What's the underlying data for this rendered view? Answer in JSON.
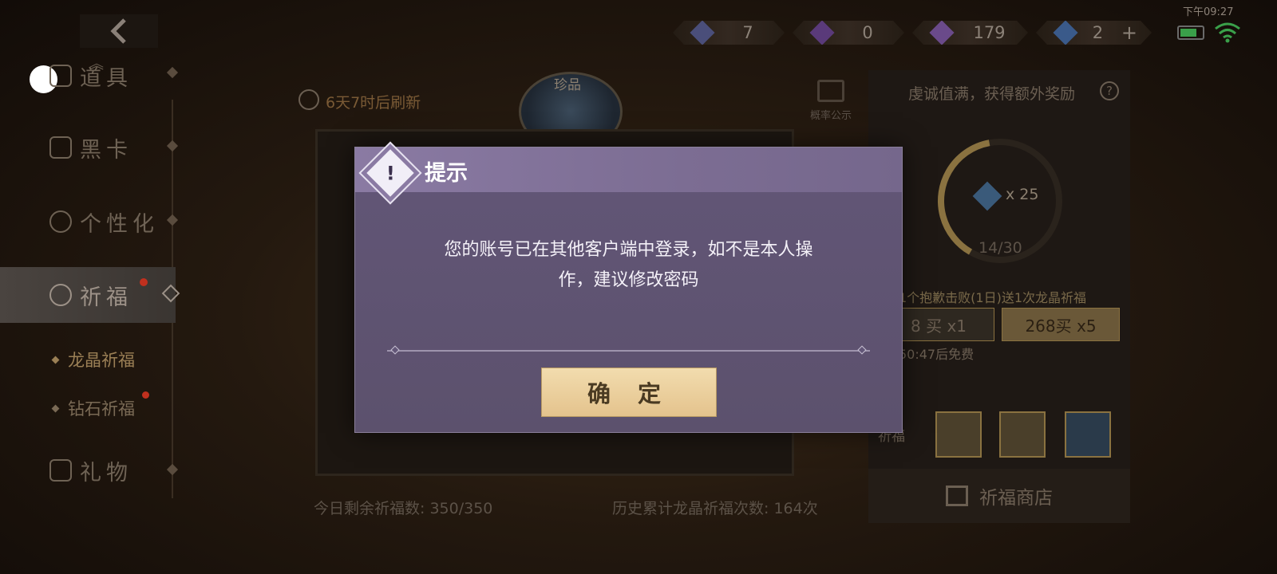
{
  "status": {
    "time": "下午09:27"
  },
  "resources": [
    {
      "icon": "ticket-icon",
      "value": "7"
    },
    {
      "icon": "crystal-icon",
      "value": "0"
    },
    {
      "icon": "purple-diamond-icon",
      "value": "179"
    },
    {
      "icon": "blue-diamond-icon",
      "value": "2"
    }
  ],
  "nav": {
    "items": [
      {
        "label": "道具"
      },
      {
        "label": "黑卡"
      },
      {
        "label": "个性化"
      },
      {
        "label": "祈福"
      },
      {
        "label": "礼物"
      }
    ],
    "sub_items": [
      {
        "label": "龙晶祈福"
      },
      {
        "label": "钻石祈福"
      }
    ]
  },
  "main": {
    "refresh": "6天7时后刷新",
    "badge": "珍品",
    "prob_label": "概率公示",
    "remaining": "今日剩余祈福数: 350/350",
    "history": "历史累计龙晶祈福次数: 164次"
  },
  "side": {
    "piety": "虔诚值满，获得额外奖励",
    "reward": "x 25",
    "progress": "14/30",
    "progress_value": 0.467,
    "promo": "1个抱歉击败(1日)送1次龙晶祈福",
    "buy1": "8 买 x1",
    "buy5": "268买 x5",
    "free": "50:47后免费",
    "pray": "祈福",
    "shop": "祈福商店"
  },
  "dialog": {
    "title": "提示",
    "message_line1": "您的账号已在其他客户端中登录，如不是本人操",
    "message_line2": "作，建议修改密码",
    "confirm": "确 定"
  },
  "colors": {
    "dialog_bg": "#5e5371",
    "confirm_bg": "#ecd09d",
    "accent": "#c0301e"
  }
}
